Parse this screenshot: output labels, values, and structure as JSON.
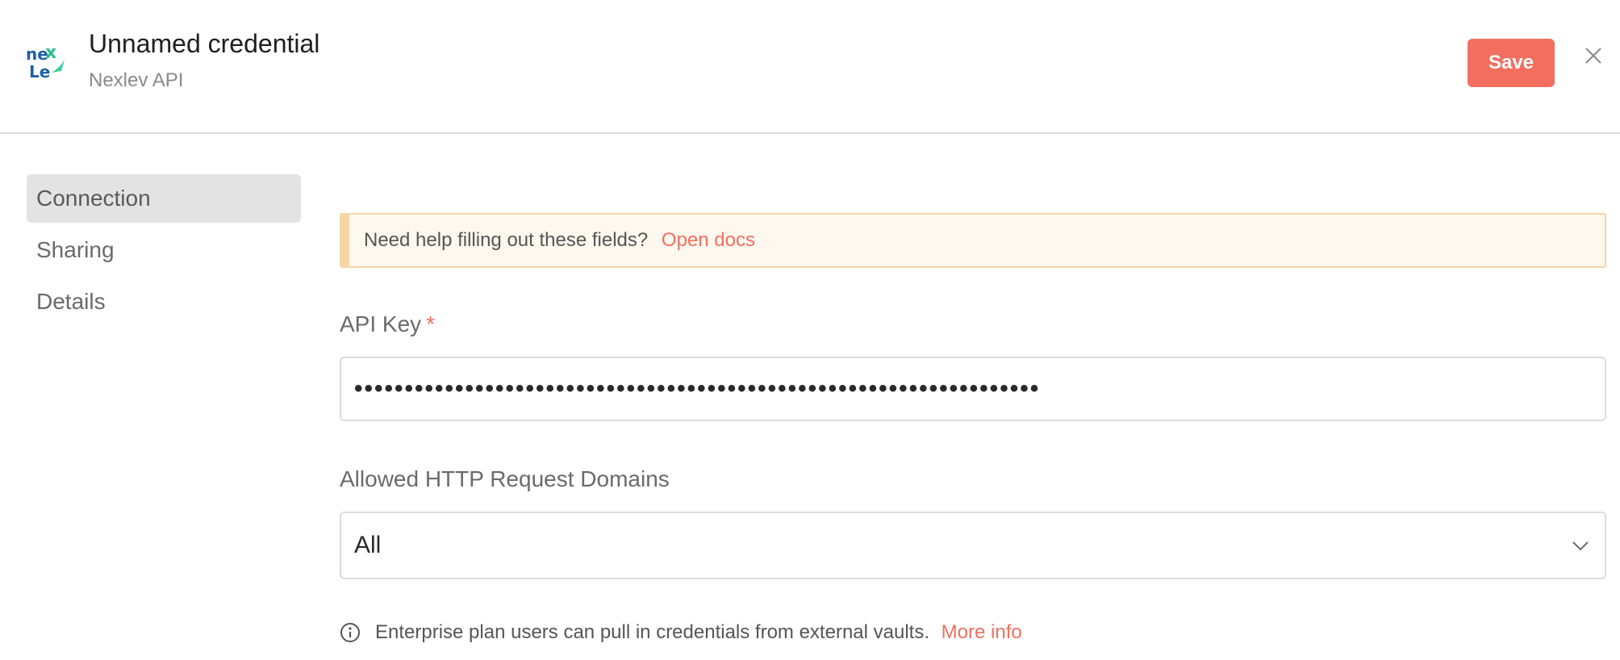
{
  "header": {
    "title": "Unnamed credential",
    "subtitle": "Nexlev API",
    "save_label": "Save",
    "logo_icon": "nexlev-logo",
    "close_icon": "close-icon"
  },
  "sidebar": {
    "items": [
      {
        "label": "Connection",
        "active": true
      },
      {
        "label": "Sharing",
        "active": false
      },
      {
        "label": "Details",
        "active": false
      }
    ]
  },
  "notice": {
    "text": "Need help filling out these fields?",
    "link": "Open docs"
  },
  "api_key": {
    "label": "API Key",
    "required_mark": "*",
    "value": "••••••••••••••••••••••••••••••••••••••••••••••••••••••••••••••••••••"
  },
  "domains": {
    "label": "Allowed HTTP Request Domains",
    "selected": "All"
  },
  "info": {
    "text": "Enterprise plan users can pull in credentials from external vaults.",
    "link": "More info"
  },
  "colors": {
    "accent": "#f26f5f",
    "notice_bg": "#fff8ee",
    "notice_border": "#f5d6a6"
  }
}
